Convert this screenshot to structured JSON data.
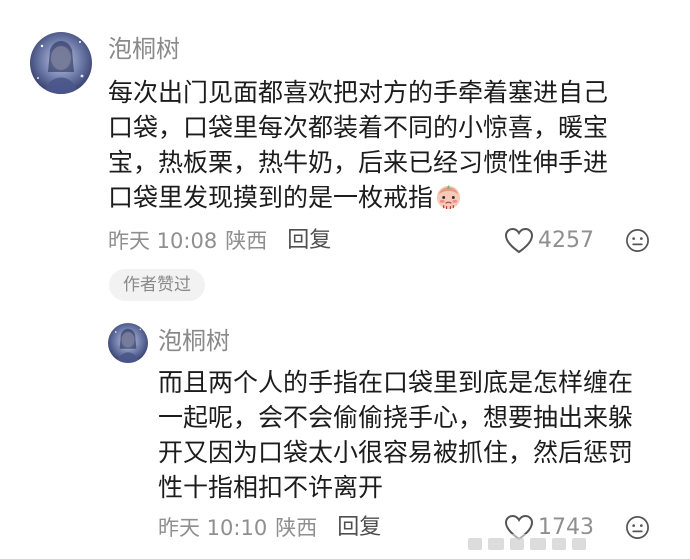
{
  "comment": {
    "username": "泡桐树",
    "content_lines": [
      "每次出门见面都喜欢把对方的手牵着塞进自己",
      "口袋，口袋里每次都装着不同的小惊喜，暖宝",
      "宝，热板栗，热牛奶，后来已经习惯性伸手进",
      "口袋里发现摸到的是一枚戒指"
    ],
    "emoji": "shy-face-emoji",
    "time": "昨天 10:08",
    "location": "陕西",
    "reply_label": "回复",
    "likes": "4257",
    "author_badge": "作者赞过"
  },
  "reply": {
    "username": "泡桐树",
    "content_lines": [
      "而且两个人的手指在口袋里到底是怎样缠在",
      "一起呢，会不会偷偷挠手心，想要抽出来躲",
      "开又因为口袋太小很容易被抓住，然后惩罚",
      "性十指相扣不许离开"
    ],
    "time": "昨天 10:10",
    "location": "陕西",
    "reply_label": "回复",
    "likes": "1743"
  },
  "icons": {
    "like": "heart-outline-icon",
    "dislike": "neutral-face-icon"
  }
}
